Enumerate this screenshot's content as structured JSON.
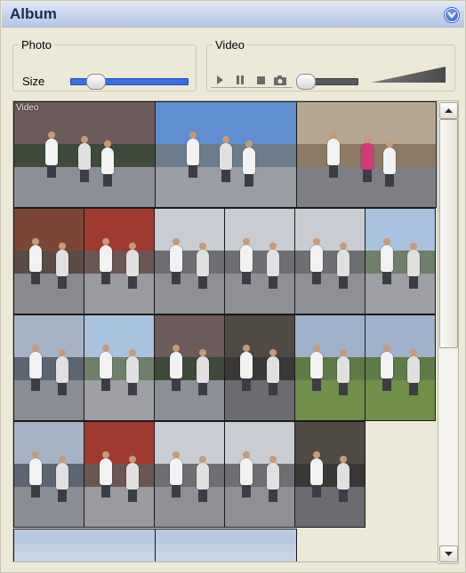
{
  "header": {
    "title": "Album",
    "collapse_icon": "chevron-down-circle-icon"
  },
  "photo_group": {
    "legend": "Photo",
    "size_label": "Size",
    "size_level": 0.2
  },
  "video_group": {
    "legend": "Video",
    "controls": [
      "play-icon",
      "pause-icon",
      "stop-icon",
      "camera-icon"
    ],
    "seek_level": 0.0
  },
  "gallery": {
    "video_tag": "Video",
    "rows": [
      {
        "cells": [
          {
            "kind": "wide",
            "scene": "trees"
          },
          {
            "kind": "wide",
            "scene": "city"
          },
          {
            "kind": "wide",
            "scene": "pink"
          }
        ]
      },
      {
        "cells": [
          {
            "scene": "bus"
          },
          {
            "scene": "bus2"
          },
          {
            "scene": "street"
          },
          {
            "scene": "street"
          },
          {
            "scene": "street"
          },
          {
            "scene": "park"
          }
        ]
      },
      {
        "cells": [
          {
            "scene": "building"
          },
          {
            "scene": "park"
          },
          {
            "scene": "trees"
          },
          {
            "scene": "dark"
          },
          {
            "scene": "grass"
          },
          {
            "scene": "grass"
          }
        ]
      },
      {
        "cells": [
          {
            "scene": "building"
          },
          {
            "scene": "bus2"
          },
          {
            "scene": "street"
          },
          {
            "scene": "street"
          },
          {
            "scene": "dark"
          }
        ]
      },
      {
        "cells": [
          {
            "kind": "wide",
            "scene": "sky"
          },
          {
            "kind": "wide",
            "scene": "sky"
          }
        ]
      }
    ]
  },
  "scrollbar": {
    "up_icon": "arrow-up-icon",
    "down_icon": "arrow-down-icon",
    "position": 0.0
  },
  "colors": {
    "accent": "#3a6ee0",
    "header_text": "#1b2a55",
    "panel_bg": "#ece9d8"
  }
}
